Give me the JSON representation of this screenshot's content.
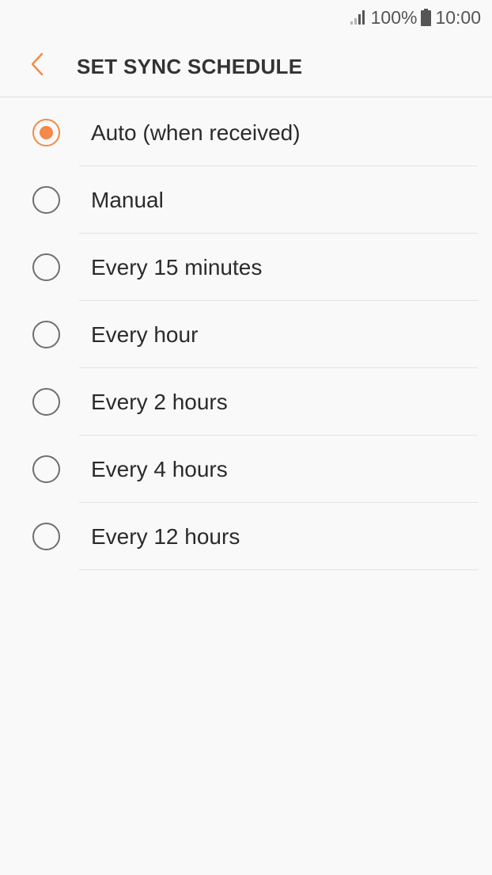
{
  "status_bar": {
    "battery_percent": "100%",
    "time": "10:00",
    "icons": [
      "signal-icon",
      "battery-icon"
    ]
  },
  "header": {
    "back_icon": "chevron-left-icon",
    "title": "SET SYNC SCHEDULE"
  },
  "colors": {
    "accent": "#f4894a",
    "background": "#f9f9f9",
    "text": "#2b2b2b",
    "radio_unselected": "#6e6e6e",
    "divider": "#e3e3e3"
  },
  "options": [
    {
      "label": "Auto (when received)",
      "selected": true
    },
    {
      "label": "Manual",
      "selected": false
    },
    {
      "label": "Every 15 minutes",
      "selected": false
    },
    {
      "label": "Every hour",
      "selected": false
    },
    {
      "label": "Every 2 hours",
      "selected": false
    },
    {
      "label": "Every 4 hours",
      "selected": false
    },
    {
      "label": "Every 12 hours",
      "selected": false
    }
  ]
}
